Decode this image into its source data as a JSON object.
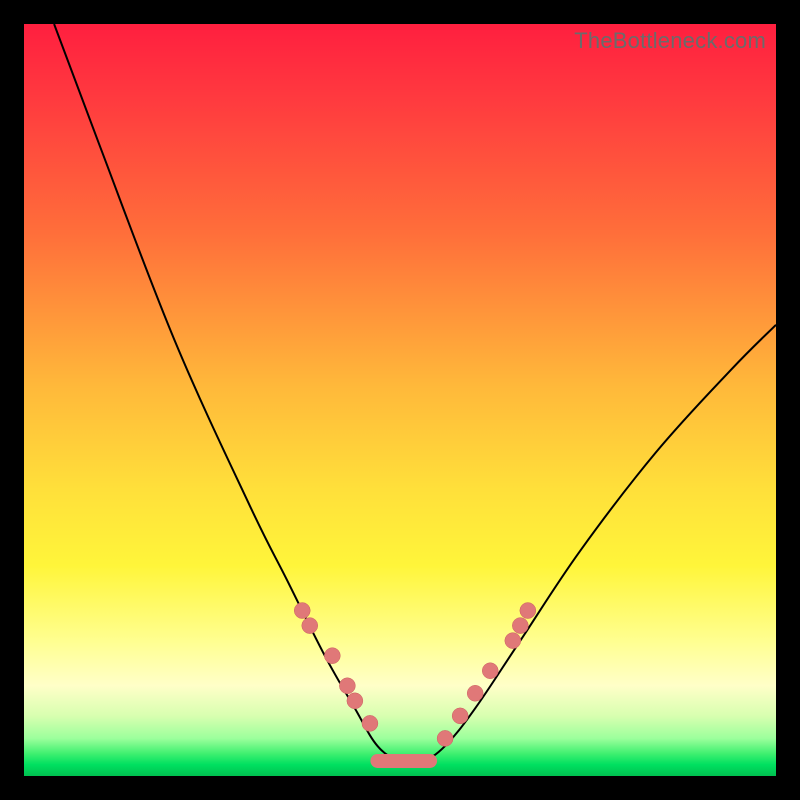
{
  "watermark": "TheBottleneck.com",
  "chart_data": {
    "type": "line",
    "title": "",
    "xlabel": "",
    "ylabel": "",
    "xlim": [
      0,
      100
    ],
    "ylim": [
      0,
      100
    ],
    "series": [
      {
        "name": "bottleneck-curve",
        "x": [
          4,
          10,
          20,
          30,
          35,
          40,
          44,
          47,
          50,
          53,
          56,
          60,
          66,
          74,
          84,
          94,
          100
        ],
        "y": [
          100,
          84,
          58,
          36,
          26,
          16,
          9,
          4,
          2,
          2,
          4,
          9,
          18,
          30,
          43,
          54,
          60
        ]
      }
    ],
    "highlight_points": {
      "left_branch": [
        {
          "x": 37,
          "y": 22
        },
        {
          "x": 38,
          "y": 20
        },
        {
          "x": 41,
          "y": 16
        },
        {
          "x": 43,
          "y": 12
        },
        {
          "x": 44,
          "y": 10
        },
        {
          "x": 46,
          "y": 7
        }
      ],
      "right_branch": [
        {
          "x": 56,
          "y": 5
        },
        {
          "x": 58,
          "y": 8
        },
        {
          "x": 60,
          "y": 11
        },
        {
          "x": 62,
          "y": 14
        },
        {
          "x": 65,
          "y": 18
        },
        {
          "x": 66,
          "y": 20
        },
        {
          "x": 67,
          "y": 22
        }
      ],
      "flat_bottom": {
        "x_start": 47,
        "x_end": 54,
        "y": 2
      }
    },
    "background_gradient": {
      "top": "#ff1f3f",
      "mid": "#ffe03a",
      "bottom": "#00c050"
    }
  }
}
